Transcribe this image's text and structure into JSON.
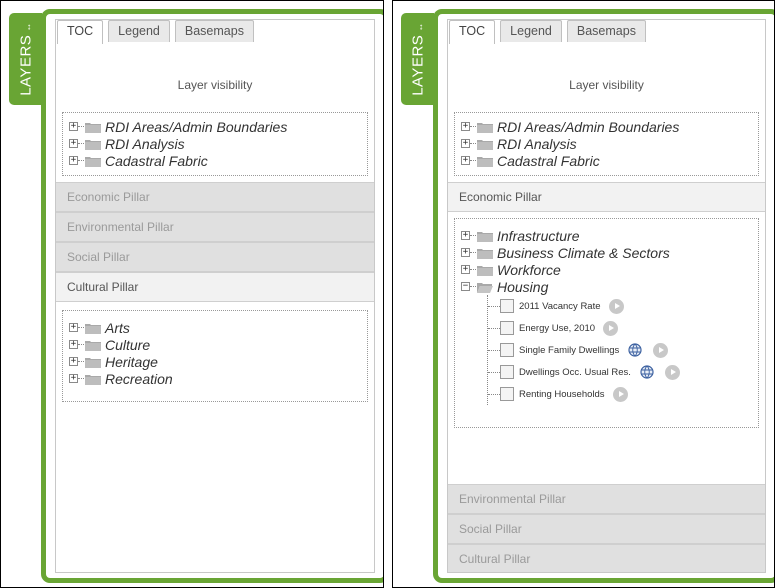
{
  "layers_tab": {
    "label": "LAYERS",
    "arrows": "↔"
  },
  "tabs": [
    "TOC",
    "Legend",
    "Basemaps"
  ],
  "layer_visibility_title": "Layer visibility",
  "top_layers": [
    "RDI Areas/Admin Boundaries",
    "RDI Analysis",
    "Cadastral Fabric"
  ],
  "pillars": {
    "economic": "Economic Pillar",
    "environmental": "Environmental Pillar",
    "social": "Social Pillar",
    "cultural": "Cultural Pillar"
  },
  "cultural_layers": [
    "Arts",
    "Culture",
    "Heritage",
    "Recreation"
  ],
  "economic_layers": [
    "Infrastructure",
    "Business Climate & Sectors",
    "Workforce",
    "Housing"
  ],
  "housing_layers": [
    "2011 Vacancy Rate",
    "Energy Use, 2010",
    "Single Family Dwellings",
    "Dwellings Occ. Usual Res.",
    "Renting Households"
  ],
  "colors": {
    "frame_green": "#69a534",
    "pillar_gray": "#e0e0e0"
  }
}
